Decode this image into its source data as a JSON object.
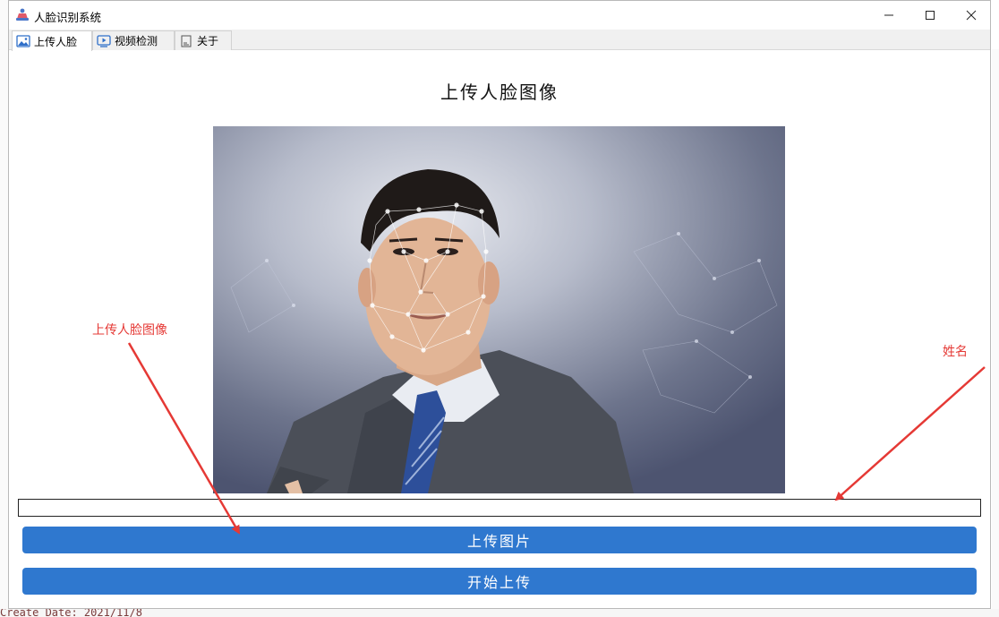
{
  "window": {
    "title": "人脸识别系统",
    "minimize_symbol": "—",
    "maximize_symbol": "☐",
    "close_symbol": "✕"
  },
  "tabs": [
    {
      "label": "上传人脸",
      "icon": "image-icon",
      "active": true
    },
    {
      "label": "视频检测",
      "icon": "video-icon",
      "active": false
    },
    {
      "label": "关于",
      "icon": "document-icon",
      "active": false
    }
  ],
  "main": {
    "heading": "上传人脸图像",
    "name_input_value": "",
    "upload_button_label": "上传图片",
    "start_button_label": "开始上传"
  },
  "annotations": {
    "left_label": "上传人脸图像",
    "right_label": "姓名",
    "color": "#e53935"
  },
  "background": {
    "bottom_text": "Create Date: 2021/11/8"
  },
  "colors": {
    "button": "#2f78cf",
    "accent": "#e53935"
  }
}
